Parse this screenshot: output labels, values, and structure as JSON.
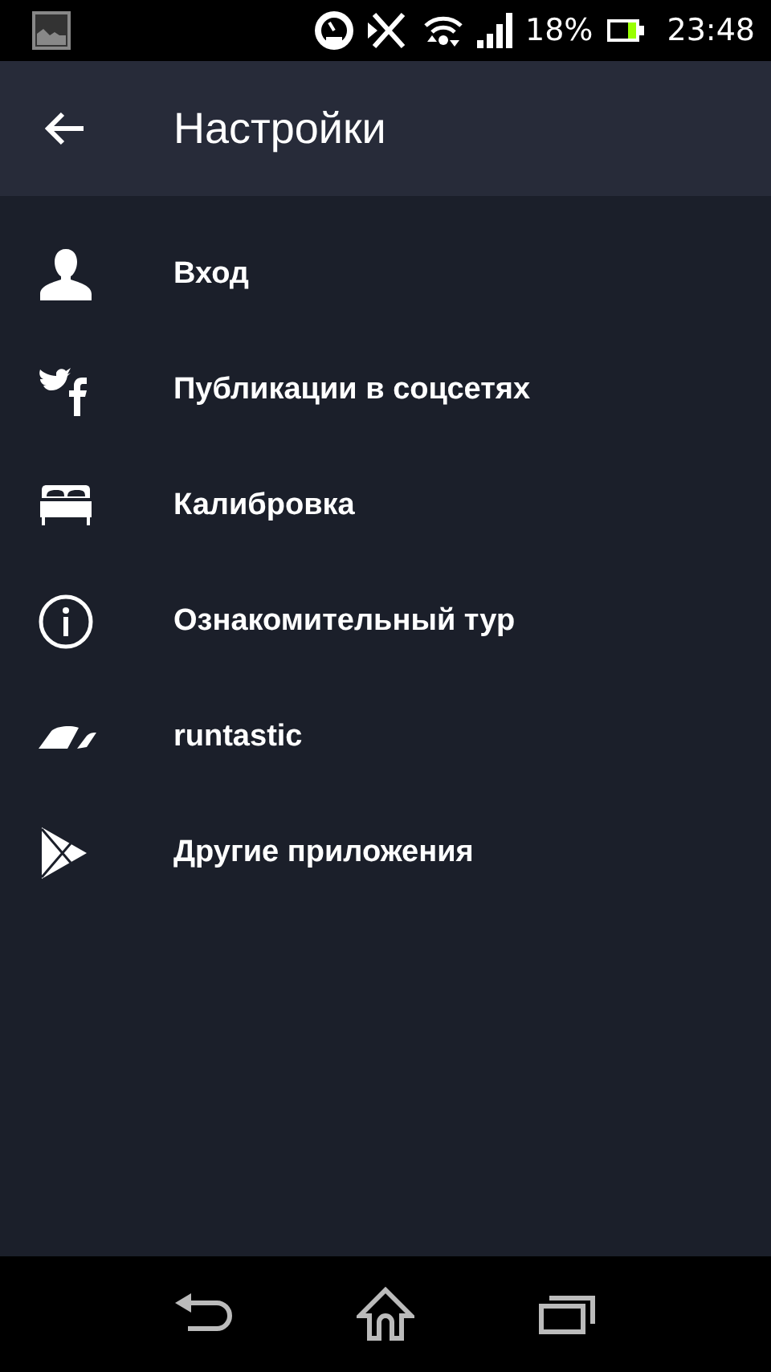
{
  "status_bar": {
    "battery": "18%",
    "time": "23:48"
  },
  "header": {
    "title": "Настройки"
  },
  "items": [
    {
      "kind": "person",
      "label": "Вход"
    },
    {
      "kind": "social",
      "label": "Публикации в соцсетях"
    },
    {
      "kind": "bed",
      "label": "Калибровка"
    },
    {
      "kind": "info",
      "label": "Ознакомительный тур"
    },
    {
      "kind": "runtastic",
      "label": "runtastic"
    },
    {
      "kind": "play",
      "label": "Другие приложения"
    }
  ]
}
